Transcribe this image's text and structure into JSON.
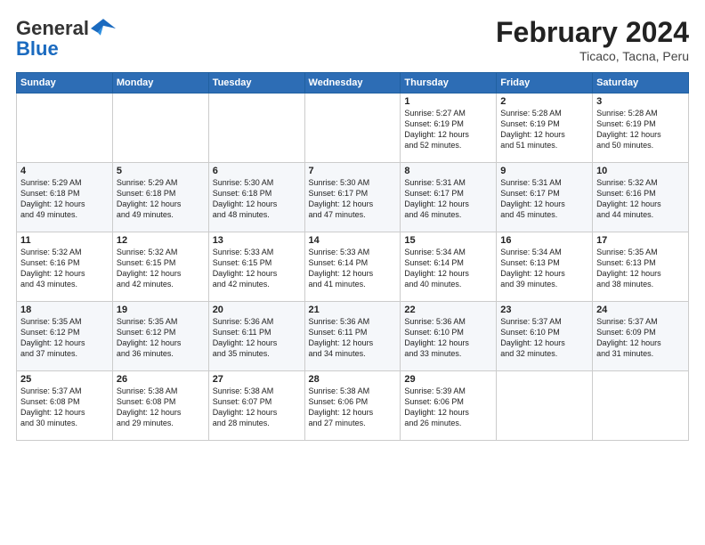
{
  "header": {
    "logo_general": "General",
    "logo_blue": "Blue",
    "month": "February 2024",
    "location": "Ticaco, Tacna, Peru"
  },
  "weekdays": [
    "Sunday",
    "Monday",
    "Tuesday",
    "Wednesday",
    "Thursday",
    "Friday",
    "Saturday"
  ],
  "weeks": [
    [
      {
        "day": "",
        "info": ""
      },
      {
        "day": "",
        "info": ""
      },
      {
        "day": "",
        "info": ""
      },
      {
        "day": "",
        "info": ""
      },
      {
        "day": "1",
        "info": "Sunrise: 5:27 AM\nSunset: 6:19 PM\nDaylight: 12 hours\nand 52 minutes."
      },
      {
        "day": "2",
        "info": "Sunrise: 5:28 AM\nSunset: 6:19 PM\nDaylight: 12 hours\nand 51 minutes."
      },
      {
        "day": "3",
        "info": "Sunrise: 5:28 AM\nSunset: 6:19 PM\nDaylight: 12 hours\nand 50 minutes."
      }
    ],
    [
      {
        "day": "4",
        "info": "Sunrise: 5:29 AM\nSunset: 6:18 PM\nDaylight: 12 hours\nand 49 minutes."
      },
      {
        "day": "5",
        "info": "Sunrise: 5:29 AM\nSunset: 6:18 PM\nDaylight: 12 hours\nand 49 minutes."
      },
      {
        "day": "6",
        "info": "Sunrise: 5:30 AM\nSunset: 6:18 PM\nDaylight: 12 hours\nand 48 minutes."
      },
      {
        "day": "7",
        "info": "Sunrise: 5:30 AM\nSunset: 6:17 PM\nDaylight: 12 hours\nand 47 minutes."
      },
      {
        "day": "8",
        "info": "Sunrise: 5:31 AM\nSunset: 6:17 PM\nDaylight: 12 hours\nand 46 minutes."
      },
      {
        "day": "9",
        "info": "Sunrise: 5:31 AM\nSunset: 6:17 PM\nDaylight: 12 hours\nand 45 minutes."
      },
      {
        "day": "10",
        "info": "Sunrise: 5:32 AM\nSunset: 6:16 PM\nDaylight: 12 hours\nand 44 minutes."
      }
    ],
    [
      {
        "day": "11",
        "info": "Sunrise: 5:32 AM\nSunset: 6:16 PM\nDaylight: 12 hours\nand 43 minutes."
      },
      {
        "day": "12",
        "info": "Sunrise: 5:32 AM\nSunset: 6:15 PM\nDaylight: 12 hours\nand 42 minutes."
      },
      {
        "day": "13",
        "info": "Sunrise: 5:33 AM\nSunset: 6:15 PM\nDaylight: 12 hours\nand 42 minutes."
      },
      {
        "day": "14",
        "info": "Sunrise: 5:33 AM\nSunset: 6:14 PM\nDaylight: 12 hours\nand 41 minutes."
      },
      {
        "day": "15",
        "info": "Sunrise: 5:34 AM\nSunset: 6:14 PM\nDaylight: 12 hours\nand 40 minutes."
      },
      {
        "day": "16",
        "info": "Sunrise: 5:34 AM\nSunset: 6:13 PM\nDaylight: 12 hours\nand 39 minutes."
      },
      {
        "day": "17",
        "info": "Sunrise: 5:35 AM\nSunset: 6:13 PM\nDaylight: 12 hours\nand 38 minutes."
      }
    ],
    [
      {
        "day": "18",
        "info": "Sunrise: 5:35 AM\nSunset: 6:12 PM\nDaylight: 12 hours\nand 37 minutes."
      },
      {
        "day": "19",
        "info": "Sunrise: 5:35 AM\nSunset: 6:12 PM\nDaylight: 12 hours\nand 36 minutes."
      },
      {
        "day": "20",
        "info": "Sunrise: 5:36 AM\nSunset: 6:11 PM\nDaylight: 12 hours\nand 35 minutes."
      },
      {
        "day": "21",
        "info": "Sunrise: 5:36 AM\nSunset: 6:11 PM\nDaylight: 12 hours\nand 34 minutes."
      },
      {
        "day": "22",
        "info": "Sunrise: 5:36 AM\nSunset: 6:10 PM\nDaylight: 12 hours\nand 33 minutes."
      },
      {
        "day": "23",
        "info": "Sunrise: 5:37 AM\nSunset: 6:10 PM\nDaylight: 12 hours\nand 32 minutes."
      },
      {
        "day": "24",
        "info": "Sunrise: 5:37 AM\nSunset: 6:09 PM\nDaylight: 12 hours\nand 31 minutes."
      }
    ],
    [
      {
        "day": "25",
        "info": "Sunrise: 5:37 AM\nSunset: 6:08 PM\nDaylight: 12 hours\nand 30 minutes."
      },
      {
        "day": "26",
        "info": "Sunrise: 5:38 AM\nSunset: 6:08 PM\nDaylight: 12 hours\nand 29 minutes."
      },
      {
        "day": "27",
        "info": "Sunrise: 5:38 AM\nSunset: 6:07 PM\nDaylight: 12 hours\nand 28 minutes."
      },
      {
        "day": "28",
        "info": "Sunrise: 5:38 AM\nSunset: 6:06 PM\nDaylight: 12 hours\nand 27 minutes."
      },
      {
        "day": "29",
        "info": "Sunrise: 5:39 AM\nSunset: 6:06 PM\nDaylight: 12 hours\nand 26 minutes."
      },
      {
        "day": "",
        "info": ""
      },
      {
        "day": "",
        "info": ""
      }
    ]
  ]
}
